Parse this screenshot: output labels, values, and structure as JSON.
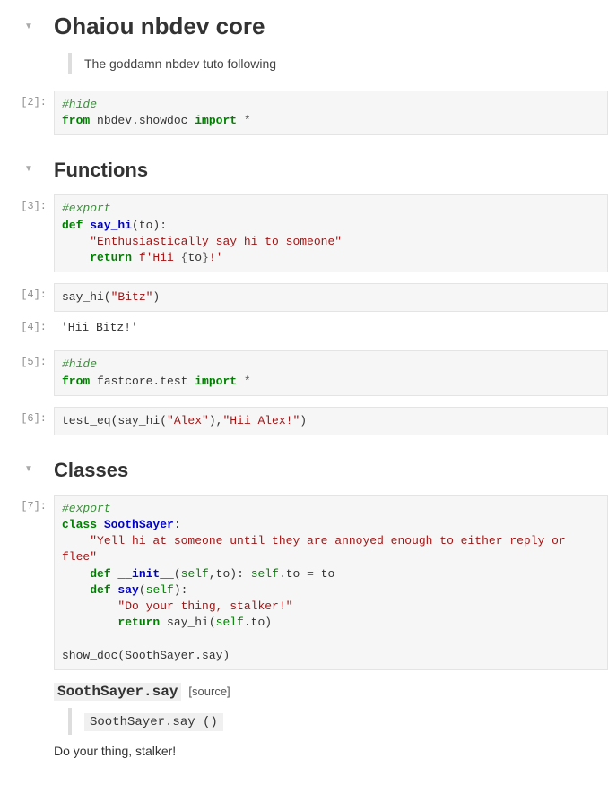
{
  "title": "Ohaiou nbdev core",
  "subtitle_quote": "The goddamn nbdev tuto following",
  "sections": {
    "functions": "Functions",
    "classes": "Classes"
  },
  "prompts": {
    "c2": "[2]:",
    "c3": "[3]:",
    "c4in": "[4]:",
    "c4out": "[4]:",
    "c5": "[5]:",
    "c6": "[6]:",
    "c7": "[7]:"
  },
  "code": {
    "c2": {
      "l1_comment": "#hide",
      "l2_from": "from",
      "l2_mod": " nbdev.showdoc ",
      "l2_import": "import",
      "l2_star": " *"
    },
    "c3": {
      "l1_comment": "#export",
      "l2_def": "def",
      "l2_name": " say_hi",
      "l2_rest": "(to):",
      "l3_doc": "    \"Enthusiastically say hi to someone\"",
      "l4_ret": "    return",
      "l4_f": " f'Hii ",
      "l4_brace1": "{",
      "l4_to": "to",
      "l4_brace2": "}",
      "l4_end": "!'"
    },
    "c4": {
      "call": "say_hi(",
      "arg": "\"Bitz\"",
      "close": ")"
    },
    "c4_out": "'Hii Bitz!'",
    "c5": {
      "l1_comment": "#hide",
      "l2_from": "from",
      "l2_mod": " fastcore.test ",
      "l2_import": "import",
      "l2_star": " *"
    },
    "c6": {
      "call": "test_eq(say_hi(",
      "arg1": "\"Alex\"",
      "mid": "),",
      "arg2": "\"Hii Alex!\"",
      "close": ")"
    },
    "c7": {
      "l1_comment": "#export",
      "l2_class": "class",
      "l2_name": " SoothSayer",
      "l2_colon": ":",
      "l3_doc": "    \"Yell hi at someone until they are annoyed enough to either reply or flee\"",
      "l4_def": "    def",
      "l4_name": " __init__",
      "l4_open": "(",
      "l4_self": "self",
      "l4_rest": ",to): ",
      "l4_selfto": "self",
      "l4_dot": ".to ",
      "l4_eq": "=",
      "l4_to": " to",
      "l5_def": "    def",
      "l5_say": " say",
      "l5_open": "(",
      "l5_self": "self",
      "l5_close": "):",
      "l6_doc": "        \"Do your thing, stalker!\"",
      "l7_ret": "        return",
      "l7_call": " say_hi(",
      "l7_self": "self",
      "l7_rest": ".to)",
      "l8_blank": "",
      "l9_show": "show_doc(SoothSayer.say)"
    }
  },
  "doc": {
    "heading_code": "SoothSayer.say",
    "source_label": "[source]",
    "signature": "SoothSayer.say",
    "sig_parens": "()",
    "body": "Do your thing, stalker!"
  }
}
